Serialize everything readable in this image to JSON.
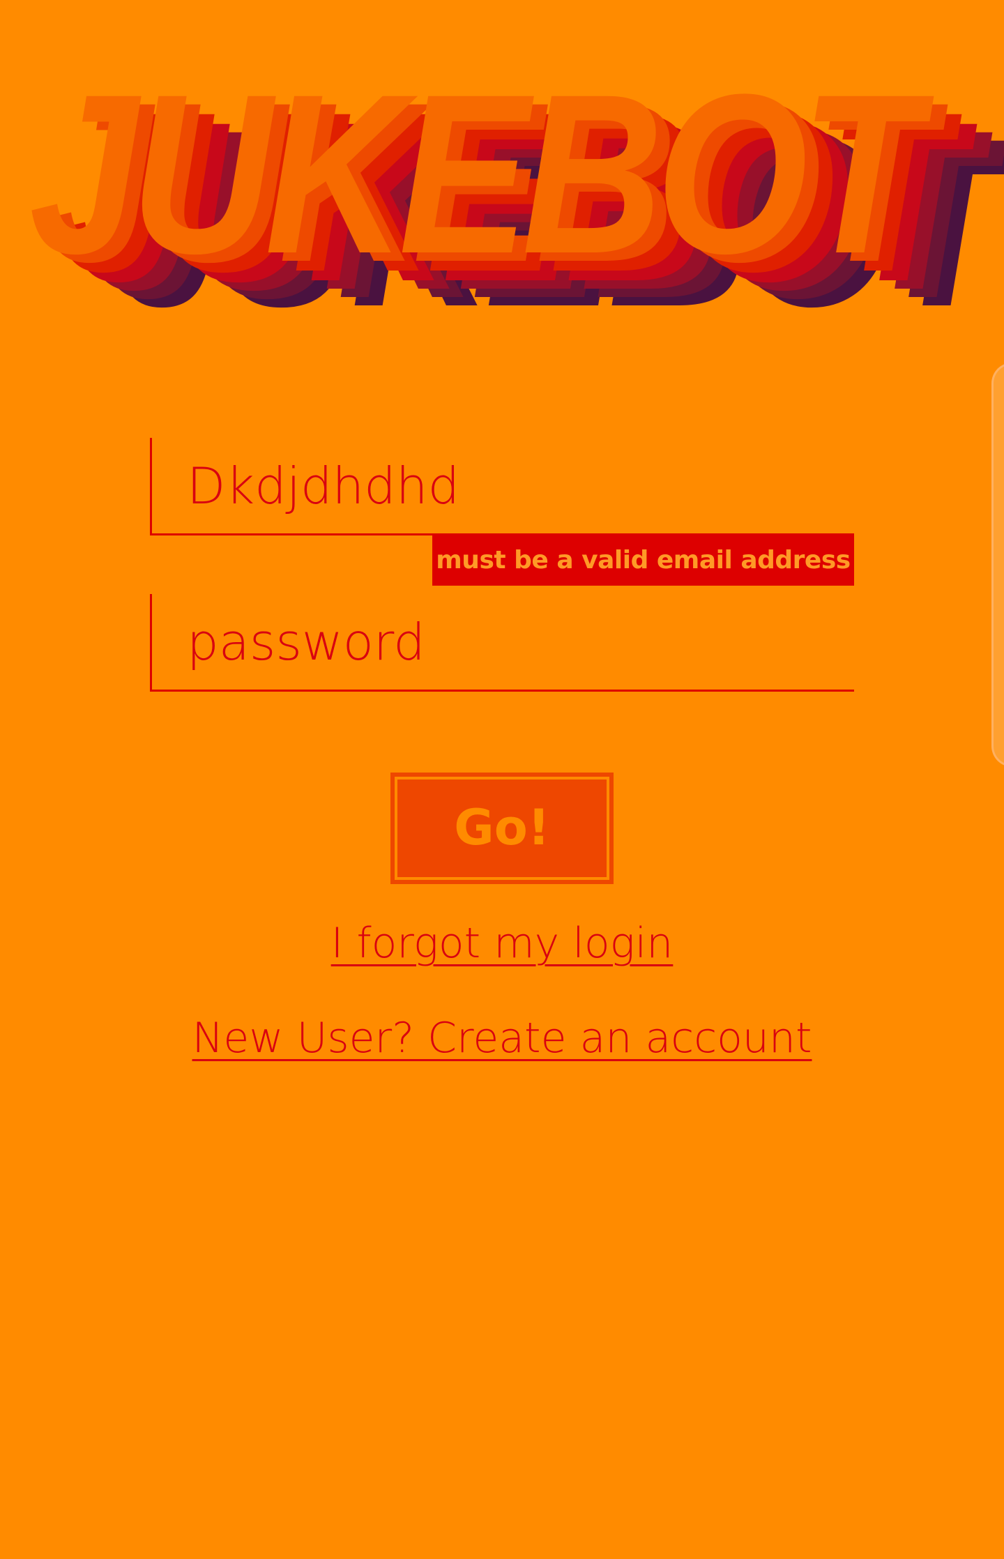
{
  "logo": {
    "text": "JUKEBOT",
    "colors": [
      "#4a1240",
      "#6b1435",
      "#98102a",
      "#c8081a",
      "#e02000",
      "#ee4a00",
      "#f76a00"
    ]
  },
  "form": {
    "email_value": "Dkdjdhdhd",
    "email_error": "must be a valid email address",
    "password_placeholder": "password",
    "submit_label": "Go!"
  },
  "links": {
    "forgot": "I forgot my login",
    "create_account": "New User? Create an account"
  },
  "colors": {
    "background": "#ff8b00",
    "accent_red": "#dd0000",
    "button": "#ee4700"
  }
}
